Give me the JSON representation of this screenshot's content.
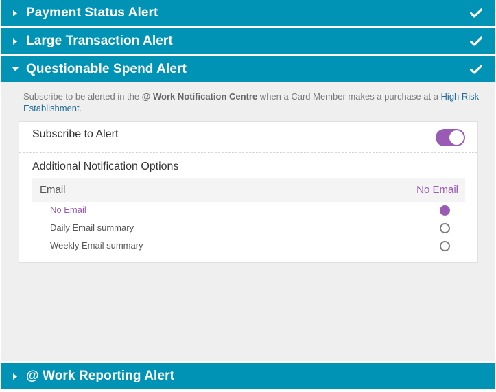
{
  "alerts": {
    "payment_status": {
      "title": "Payment Status Alert"
    },
    "large_transaction": {
      "title": "Large Transaction Alert"
    },
    "questionable_spend": {
      "title": "Questionable Spend Alert",
      "description_prefix": "Subscribe to be alerted in the ",
      "description_strong": "@ Work Notification Centre",
      "description_middle": " when a Card Member makes a purchase at a ",
      "description_link": "High Risk Establishment",
      "description_suffix": ".",
      "subscribe_label": "Subscribe to Alert",
      "subscribed": true,
      "options_title": "Additional Notification Options",
      "email": {
        "label": "Email",
        "selected_value": "No Email",
        "options": [
          {
            "label": "No Email",
            "selected": true
          },
          {
            "label": "Daily Email summary",
            "selected": false
          },
          {
            "label": "Weekly Email summary",
            "selected": false
          }
        ]
      }
    },
    "work_reporting": {
      "title": "@ Work Reporting Alert"
    }
  },
  "icons": {
    "collapsed_arrow": "caret-right-icon",
    "expanded_arrow": "caret-down-icon",
    "status": "checkmark-icon"
  },
  "colors": {
    "header_bg": "#0093b5",
    "accent": "#9a5bb5",
    "link": "#1e6d9a",
    "panel_bg": "#efefef"
  }
}
